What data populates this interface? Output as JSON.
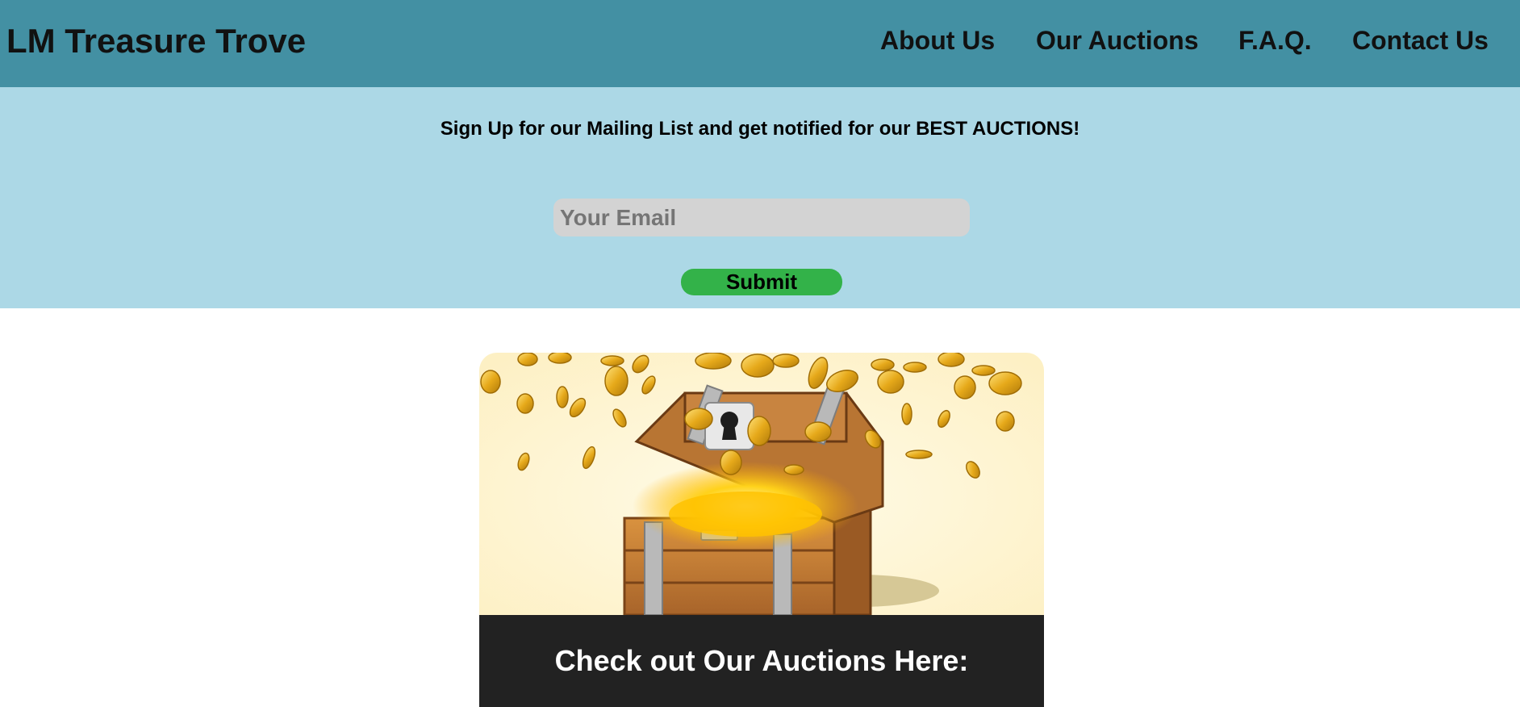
{
  "header": {
    "brand": "LM Treasure Trove",
    "nav": [
      "About Us",
      "Our Auctions",
      "F.A.Q.",
      "Contact Us"
    ]
  },
  "signup": {
    "message": "Sign Up for our Mailing List and get notified for our BEST AUCTIONS!",
    "email_placeholder": "Your Email",
    "email_value": "",
    "submit_label": "Submit"
  },
  "feature_card": {
    "image": "treasure-chest-with-gold-coins",
    "caption": "Check out Our Auctions Here:"
  },
  "colors": {
    "header_bg": "#4390a3",
    "signup_bg": "#acd8e6",
    "input_bg": "#d3d3d3",
    "submit_bg": "#33b249",
    "caption_bg": "#222222"
  }
}
